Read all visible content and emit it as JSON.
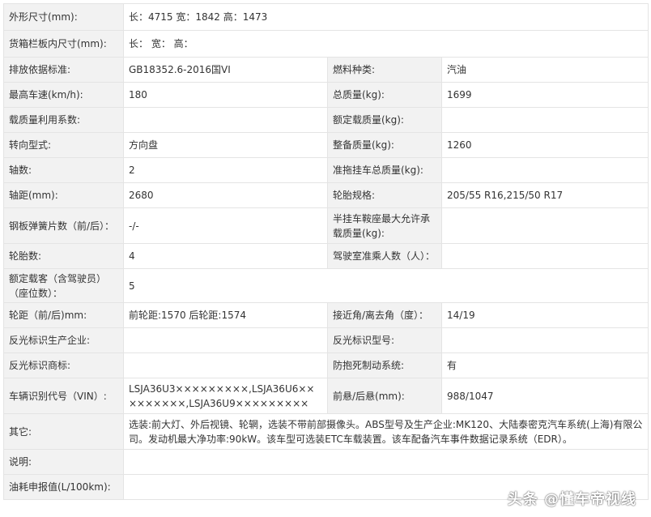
{
  "rows": [
    {
      "label": "外形尺寸(mm):",
      "value": "长：4715 宽：1842 高：1473"
    },
    {
      "label": "货箱栏板内尺寸(mm):",
      "value": "长： 宽： 高："
    },
    {
      "label": "排放依据标准:",
      "value": "GB18352.6-2016国VI",
      "label2": "燃料种类:",
      "value2": "汽油"
    },
    {
      "label": "最高车速(km/h):",
      "value": "180",
      "label2": "总质量(kg):",
      "value2": "1699"
    },
    {
      "label": "载质量利用系数:",
      "value": "",
      "label2": "额定载质量(kg):",
      "value2": ""
    },
    {
      "label": "转向型式:",
      "value": "方向盘",
      "label2": "整备质量(kg):",
      "value2": "1260"
    },
    {
      "label": "轴数:",
      "value": "2",
      "label2": "准拖挂车总质量(kg):",
      "value2": ""
    },
    {
      "label": "轴距(mm):",
      "value": "2680",
      "label2": "轮胎规格:",
      "value2": "205/55 R16,215/50 R17"
    },
    {
      "label": "钢板弹簧片数（前/后）：",
      "value": "-/-",
      "label2": "半挂车鞍座最大允许承载质量(kg):",
      "value2": ""
    },
    {
      "label": "轮胎数:",
      "value": "4",
      "label2": "驾驶室准乘人数（人）：",
      "value2": ""
    },
    {
      "label": "额定载客（含驾驶员）（座位数）：",
      "value": "5"
    },
    {
      "label": "轮距（前/后)mm:",
      "value": "前轮距:1570 后轮距:1574",
      "label2": "接近角/离去角（度）：",
      "value2": "14/19"
    },
    {
      "label": "反光标识生产企业:",
      "value": "",
      "label2": "反光标识型号:",
      "value2": ""
    },
    {
      "label": "反光标识商标:",
      "value": "",
      "label2": "防抱死制动系统:",
      "value2": "有"
    },
    {
      "label": "车辆识别代号（VIN）:",
      "value": "LSJA36U3×××××××××,LSJA36U6×××××××××,LSJA36U9×××××××××",
      "label2": "前悬/后悬(mm):",
      "value2": "988/1047"
    },
    {
      "label": "其它:",
      "value": "选装:前大灯、外后视镜、轮辋，选装不带前部摄像头。ABS型号及生产企业:MK120、大陆泰密克汽车系统(上海)有限公司。发动机最大净功率:90kW。该车型可选装ETC车载装置。该车配备汽车事件数据记录系统（EDR）。"
    },
    {
      "label": "说明:",
      "value": ""
    },
    {
      "label": "油耗申报值(L/100km):",
      "value": ""
    }
  ],
  "watermark": "头条 @懂车帝视线"
}
